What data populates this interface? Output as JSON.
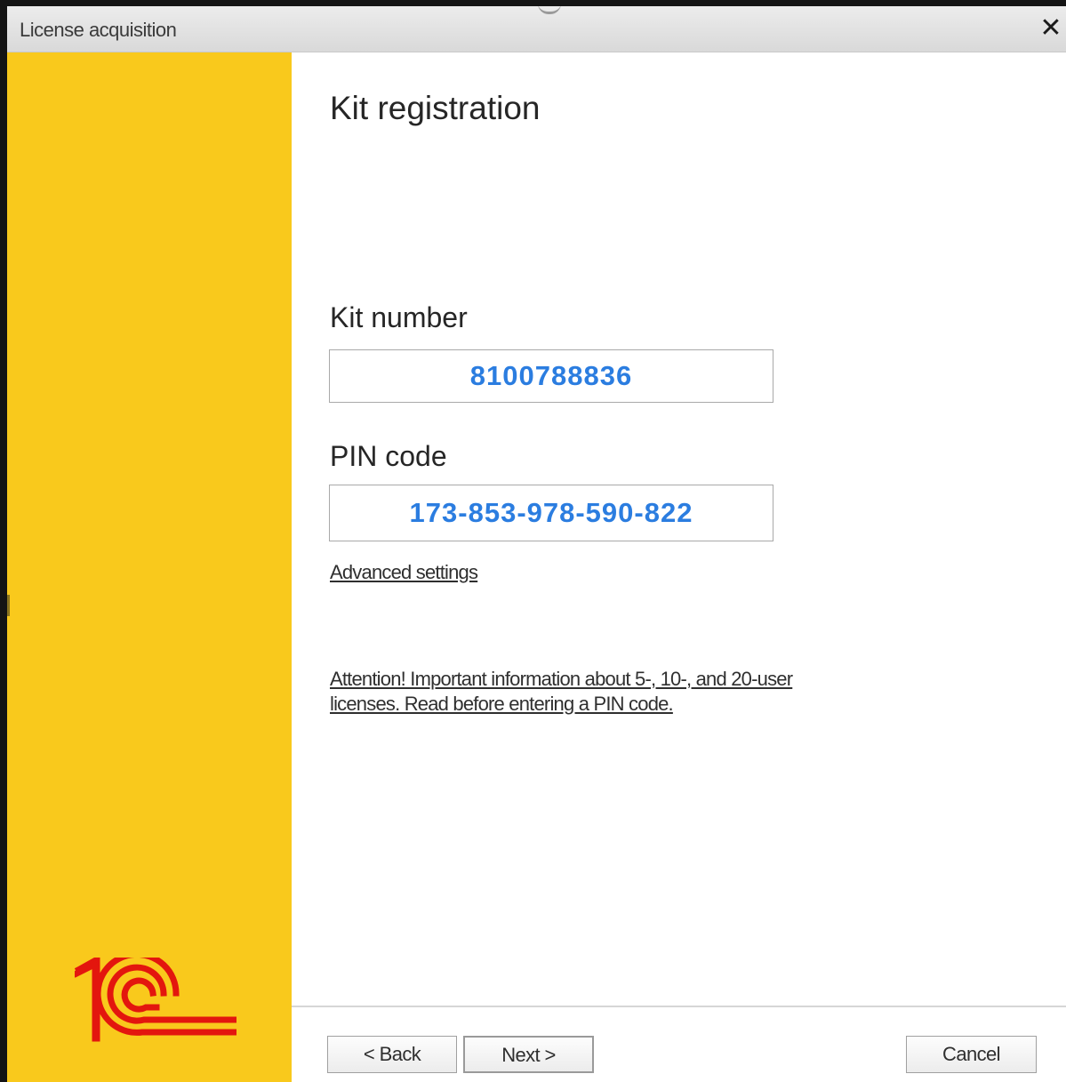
{
  "window": {
    "title": "License acquisition",
    "close_glyph": "✕"
  },
  "main": {
    "heading": "Kit registration",
    "kit_number": {
      "label": "Kit number",
      "value": "8100788836"
    },
    "pin_code": {
      "label": "PIN code",
      "value": "173-853-978-590-822"
    },
    "advanced_link": "Advanced settings",
    "attention_link_line1": "Attention! Important information about 5-, 10-, and 20-user",
    "attention_link_line2": "licenses. Read before entering a PIN code."
  },
  "buttons": {
    "back": "< Back",
    "next": "Next >",
    "cancel": "Cancel"
  },
  "icons": {
    "logo": "1c-logo",
    "close": "close-icon"
  },
  "colors": {
    "sidebar": "#f9c91c",
    "logo_red": "#e3160e",
    "field_value": "#2b7de0"
  }
}
